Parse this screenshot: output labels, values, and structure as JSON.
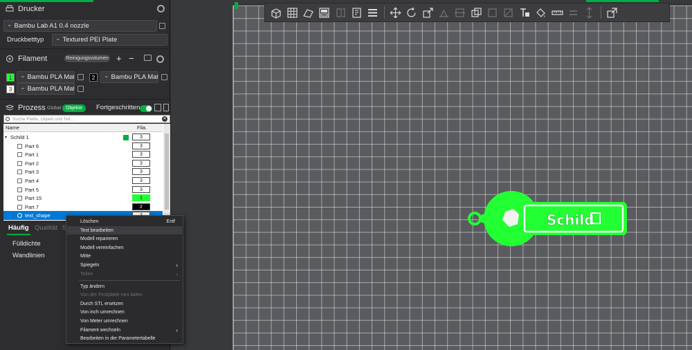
{
  "printer": {
    "header": "Drucker",
    "preset": "Bambu Lab A1 0.4 nozzle",
    "bed_label": "Druckbetttyp",
    "bed_value": "Textured PEI Plate"
  },
  "filament": {
    "header": "Filament",
    "flush_button": "Reinigungsvolumen",
    "add": "+",
    "remove": "−",
    "slots": [
      {
        "num": "1",
        "name": "Bambu PLA Matte",
        "color": "#22ff33"
      },
      {
        "num": "2",
        "name": "Bambu PLA Matte",
        "color": "#000000"
      },
      {
        "num": "3",
        "name": "Bambu PLA Matte",
        "color": "#ffffff"
      }
    ]
  },
  "process": {
    "header": "Prozess",
    "global": "Global",
    "objects": "Objekte",
    "advanced": "Fortgeschritten"
  },
  "search": {
    "placeholder": "Suche Platte, Objekt und Teil..."
  },
  "tree": {
    "col_name": "Name",
    "col_fila": "Fila.",
    "object": {
      "name": "Schild 1",
      "fila": "3"
    },
    "parts": [
      {
        "name": "Part 6",
        "fila": "3",
        "bg": "#ffffff"
      },
      {
        "name": "Part 1",
        "fila": "3",
        "bg": "#ffffff"
      },
      {
        "name": "Part 2",
        "fila": "3",
        "bg": "#ffffff"
      },
      {
        "name": "Part 3",
        "fila": "3",
        "bg": "#ffffff"
      },
      {
        "name": "Part 4",
        "fila": "3",
        "bg": "#ffffff"
      },
      {
        "name": "Part 5",
        "fila": "3",
        "bg": "#ffffff"
      },
      {
        "name": "Part 15",
        "fila": "1",
        "bg": "#22ff33"
      },
      {
        "name": "Part 7",
        "fila": "2",
        "bg": "#000000"
      },
      {
        "name": "text_shape",
        "fila": "3",
        "bg": "#ffffff"
      }
    ]
  },
  "tabs": {
    "frequent": "Häufig",
    "quality": "Qualität",
    "support": "S"
  },
  "params": {
    "infill": "Fülldichte",
    "walls": "Wandlinien"
  },
  "context_menu": {
    "items": [
      {
        "label": "Löschen",
        "shortcut": "Entf"
      },
      {
        "label": "Text bearbeiten",
        "shortcut": ""
      },
      {
        "label": "Modell reparieren",
        "shortcut": ""
      },
      {
        "label": "Modell vereinfachen",
        "shortcut": ""
      },
      {
        "label": "Mitte",
        "shortcut": ""
      },
      {
        "label": "Spiegeln",
        "shortcut": ""
      },
      {
        "label": "Teilen",
        "shortcut": ""
      },
      {
        "label": "Typ ändern",
        "shortcut": ""
      },
      {
        "label": "Von der Festplatte neu laden",
        "shortcut": ""
      },
      {
        "label": "Durch STL ersetzen",
        "shortcut": ""
      },
      {
        "label": "Von inch umrechnen",
        "shortcut": ""
      },
      {
        "label": "Von Meter umrechnen",
        "shortcut": ""
      },
      {
        "label": "Filament wechseln",
        "shortcut": ""
      },
      {
        "label": "Bearbeiten in der Parametertabelle",
        "shortcut": ""
      }
    ]
  },
  "model": {
    "text": "Schild",
    "color": "#22ff33"
  },
  "colors": {
    "accent": "#00ae42",
    "selection": "#0078d7"
  }
}
